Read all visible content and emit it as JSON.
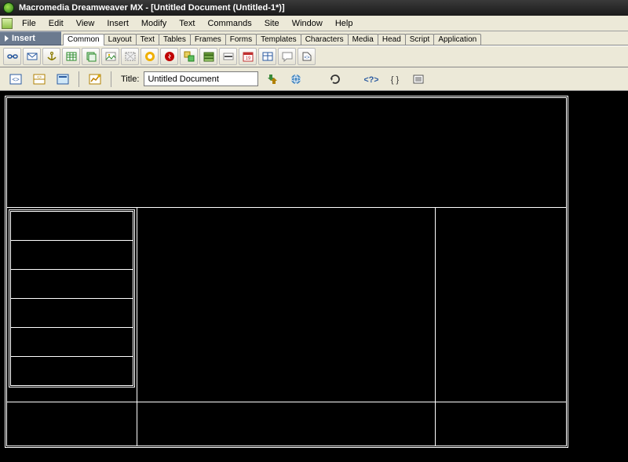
{
  "titlebar": {
    "text": "Macromedia Dreamweaver MX - [Untitled Document (Untitled-1*)]"
  },
  "menu": {
    "items": [
      "File",
      "Edit",
      "View",
      "Insert",
      "Modify",
      "Text",
      "Commands",
      "Site",
      "Window",
      "Help"
    ]
  },
  "insert_panel": {
    "label": "Insert",
    "tabs": [
      "Common",
      "Layout",
      "Text",
      "Tables",
      "Frames",
      "Forms",
      "Templates",
      "Characters",
      "Media",
      "Head",
      "Script",
      "Application"
    ],
    "active_tab": "Common",
    "buttons": [
      "hyperlink-icon",
      "email-link-icon",
      "named-anchor-icon",
      "table-icon",
      "layer-icon",
      "image-icon",
      "image-placeholder-icon",
      "fireworks-icon",
      "flash-icon",
      "rollover-icon",
      "navbar-icon",
      "hr-icon",
      "date-icon",
      "tabular-icon",
      "comment-icon",
      "tag-chooser-icon"
    ]
  },
  "doc_toolbar": {
    "title_label": "Title:",
    "title_value": "Untitled Document",
    "view_buttons": [
      "code-view-icon",
      "split-view-icon",
      "design-view-icon"
    ],
    "live_button": "live-data-icon",
    "right_buttons": [
      "file-mgmt-icon",
      "preview-icon",
      "refresh-icon",
      "reference-icon",
      "code-nav-icon",
      "view-options-icon"
    ]
  },
  "colors": {
    "panel_header": "#6b7a8f",
    "toolbar_bg": "#ece9d8"
  }
}
